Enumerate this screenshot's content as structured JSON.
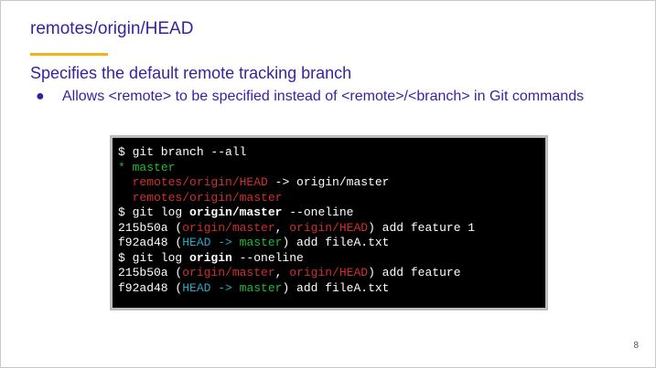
{
  "slide": {
    "title": "remotes/origin/HEAD",
    "heading": "Specifies the default remote tracking branch",
    "bullet_marker": "●",
    "bullet": "Allows <remote> to be specified instead of <remote>/<branch> in Git commands",
    "page_number": "8",
    "colors": {
      "title": "#3a1f9e",
      "accent_line": "#f2b21c",
      "terminal_bg": "#000000",
      "green": "#22b83a",
      "red": "#cf2f2f",
      "cyan": "#2aa6c4"
    }
  },
  "terminal": {
    "line1": {
      "text": "$ git branch --all"
    },
    "line2": {
      "star": "* ",
      "branch": "master"
    },
    "line3": {
      "indent": "  ",
      "ref": "remotes/origin/HEAD",
      "arrow": " -> origin/master"
    },
    "line4": {
      "indent": "  ",
      "ref": "remotes/origin/master"
    },
    "line5": {
      "prefix": "$ git log ",
      "ref": "origin/master",
      "suffix": " --oneline"
    },
    "line6": {
      "hash": "215b50a (",
      "ref1": "origin/master",
      "sep": ", ",
      "ref2": "origin/HEAD",
      "msg": ") add feature 1"
    },
    "line7": {
      "hash": "f92ad48 (",
      "head": "HEAD ->",
      "sp": " ",
      "branch": "master",
      "msg": ") add fileA.txt"
    },
    "line8": {
      "prefix": "$ git log ",
      "ref": "origin",
      "suffix": " --oneline"
    },
    "line9": {
      "hash": "215b50a (",
      "ref1": "origin/master",
      "sep": ", ",
      "ref2": "origin/HEAD",
      "msg": ") add feature"
    },
    "line10": {
      "hash": "f92ad48 (",
      "head": "HEAD ->",
      "sp": " ",
      "branch": "master",
      "msg": ") add fileA.txt"
    }
  }
}
